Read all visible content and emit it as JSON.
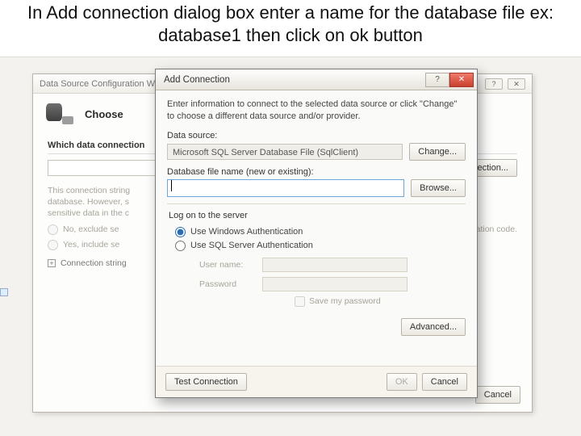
{
  "instruction": "In Add connection dialog box enter a name for the database file ex: database1 then click on ok button",
  "wizard": {
    "title": "Data Source Configuration Wizard",
    "choose": "Choose",
    "question": "Which data connection",
    "new_connection": "New Connection...",
    "note": "This connection string appears to contain sensitive data (for example, a password), which is required to connect to the database. However, storing sensitive data in the connection string can be a security risk. Do you want to include this sensitive data in the connection string?",
    "opt_no": "No, exclude se",
    "opt_yes": "Yes, include se",
    "opt_no_tail": "plication code.",
    "conn_string": "Connection string",
    "cancel": "Cancel"
  },
  "dialog": {
    "title": "Add Connection",
    "info": "Enter information to connect to the selected data source or click \"Change\" to choose a different data source and/or provider.",
    "data_source_label": "Data source:",
    "data_source_value": "Microsoft SQL Server Database File (SqlClient)",
    "change": "Change...",
    "db_file_label": "Database file name (new or existing):",
    "browse": "Browse...",
    "logon_group": "Log on to the server",
    "auth_windows": "Use Windows Authentication",
    "auth_sql": "Use SQL Server Authentication",
    "username_label": "User name:",
    "password_label": "Password",
    "save_password": "Save my password",
    "advanced": "Advanced...",
    "test": "Test Connection",
    "ok": "OK",
    "cancel": "Cancel"
  }
}
